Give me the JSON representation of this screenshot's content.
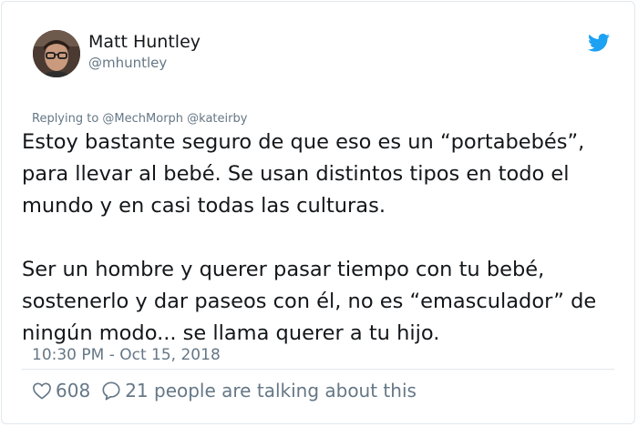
{
  "author": {
    "display_name": "Matt Huntley",
    "handle": "@mhuntley"
  },
  "replying_to": "Replying to @MechMorph @kateirby",
  "tweet": {
    "paragraph_1": "Estoy bastante seguro de que eso es un “portabebés”, para llevar al bebé. Se usan distintos tipos en todo el mundo y en casi todas las culturas.",
    "paragraph_2": "Ser un hombre y querer pasar tiempo con tu bebé, sostenerlo y dar paseos con él, no es “emasculador” de ningún modo... se llama querer a tu hijo."
  },
  "timestamp": "10:30 PM - Oct 15, 2018",
  "engagement": {
    "likes": "608",
    "talking": "21 people are talking about this"
  },
  "icons": {
    "logo": "twitter-bird-icon",
    "like": "heart-icon",
    "reply": "speech-bubble-icon"
  },
  "colors": {
    "brand": "#1da1f2",
    "secondary_text": "#657786",
    "primary_text": "#14171a"
  }
}
